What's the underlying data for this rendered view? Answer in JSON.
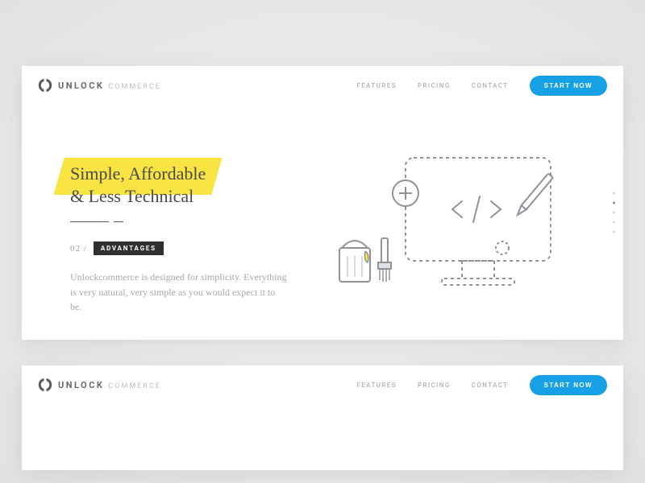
{
  "brand": {
    "main": "UNLOCK",
    "sub": "COMMERCE"
  },
  "nav": {
    "links": [
      "FEATURES",
      "PRICING",
      "CONTACT"
    ],
    "cta": "START NOW"
  },
  "hero": {
    "headline_line1": "Simple, Affordable",
    "headline_line2": "& Less Technical",
    "slide_num": "02 /",
    "slide_tag": "ADVANTAGES",
    "body": "Unlockcommerce is designed for simplicity. Everything is very natural, very simple as you would expect it to be."
  },
  "pager": {
    "total": 5,
    "active": 1
  },
  "colors": {
    "accent": "#16a1e6",
    "highlight": "#f8e442"
  }
}
